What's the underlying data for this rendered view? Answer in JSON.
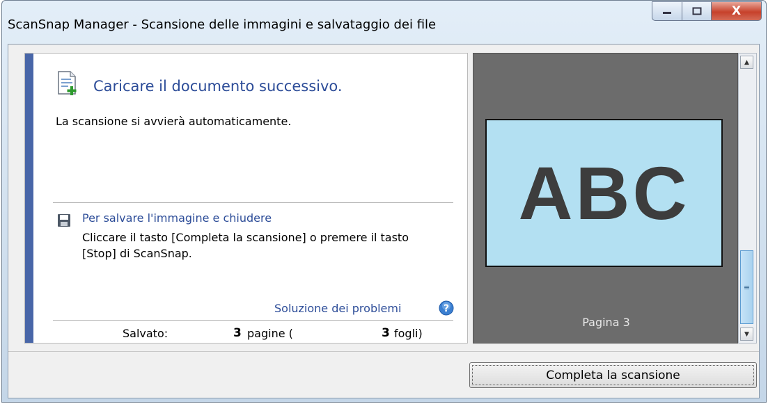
{
  "window": {
    "title": "ScanSnap Manager - Scansione delle immagini e salvataggio dei file",
    "controls": {
      "minimize": "—",
      "maximize": "□",
      "close": "X"
    }
  },
  "status": {
    "heading": "Caricare il documento successivo.",
    "message": "La scansione si avvierà automaticamente."
  },
  "save_info": {
    "title": "Per salvare l'immagine e chiudere",
    "text": "Cliccare il tasto [Completa la scansione] o premere il tasto [Stop] di ScanSnap."
  },
  "troubleshooting": {
    "link": "Soluzione dei problemi"
  },
  "saved": {
    "label": "Salvato:",
    "pages": "3",
    "pages_text": "pagine (",
    "sheets": "3",
    "sheets_text": "fogli)"
  },
  "preview": {
    "image_text": "ABC",
    "page_label": "Pagina 3",
    "image_color": "#b3e0f2"
  },
  "icons": [
    "document-add-icon",
    "floppy-disk-icon",
    "help-icon",
    "scroll-up-icon",
    "scroll-down-icon"
  ],
  "buttons": {
    "finish": "Completa la scansione"
  },
  "colors": {
    "accent": "#4866a8",
    "link": "#2c4c98",
    "preview_bg": "#6c6c6c"
  }
}
